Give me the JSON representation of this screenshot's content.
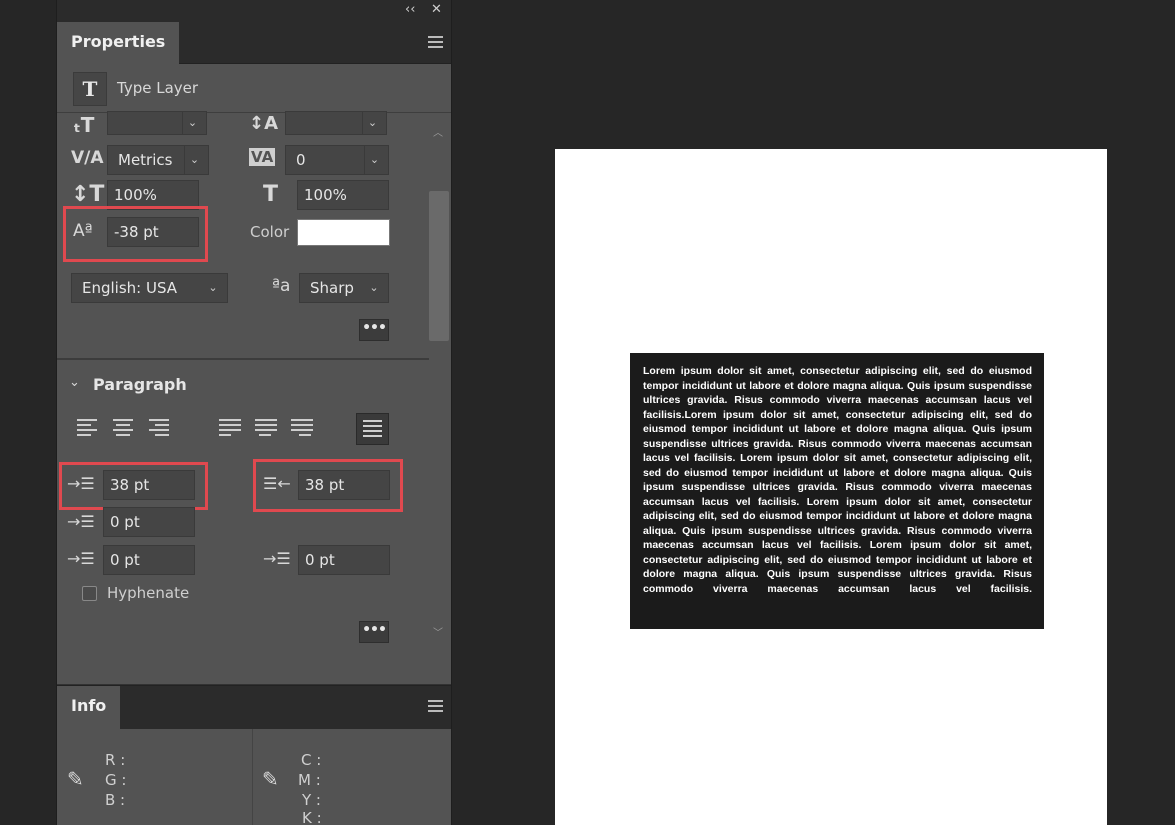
{
  "window": {
    "collapse_label": "‹‹",
    "close_label": "✕"
  },
  "properties": {
    "tab_label": "Properties",
    "layer_type_label": "Type Layer",
    "character": {
      "font_size_value": "",
      "leading_value": "",
      "kerning_value": "Metrics",
      "tracking_value": "0",
      "vertical_scale_value": "100%",
      "horizontal_scale_value": "100%",
      "baseline_shift_value": "-38 pt",
      "color_label": "Color",
      "color_value": "#ffffff",
      "language_value": "English: USA",
      "antialias_icon_text": "ªa",
      "antialias_value": "Sharp",
      "more_label": "•••"
    },
    "paragraph": {
      "section_title": "Paragraph",
      "indent_left_value": "38 pt",
      "indent_right_value": "38 pt",
      "indent_first_line_value": "0 pt",
      "space_before_value": "0 pt",
      "space_after_value": "0 pt",
      "hyphenate_label": "Hyphenate",
      "hyphenate_checked": false,
      "more_label": "•••"
    }
  },
  "info": {
    "tab_label": "Info",
    "rgb_labels": [
      "R :",
      "G :",
      "B :"
    ],
    "cmyk_labels": [
      "C :",
      "M :",
      "Y :",
      "K :"
    ]
  },
  "document": {
    "text": "Lorem ipsum dolor sit amet, consectetur adipiscing elit, sed do eiusmod tempor incididunt ut labore et dolore magna aliqua. Quis ipsum suspendisse ultrices gravida. Risus commodo viverra maecenas accumsan lacus vel facilisis.Lorem ipsum dolor sit amet, consectetur adipiscing elit, sed do eiusmod tempor incididunt ut labore et dolore magna aliqua. Quis ipsum suspendisse ultrices gravida. Risus commodo viverra maecenas accumsan lacus vel facilisis. Lorem ipsum dolor sit amet, consectetur adipiscing elit, sed do eiusmod tempor incididunt ut labore et dolore magna aliqua. Quis ipsum suspendisse ultrices gravida. Risus commodo viverra maecenas accumsan lacus vel facilisis. Lorem ipsum dolor sit amet, consectetur adipiscing elit, sed do eiusmod tempor incididunt ut labore et dolore magna aliqua. Quis ipsum suspendisse ultrices gravida. Risus commodo viverra maecenas accumsan lacus vel facilisis. Lorem ipsum dolor sit amet, consectetur adipiscing elit, sed do eiusmod tempor incididunt ut labore et dolore magna aliqua. Quis ipsum suspendisse ultrices gravida. Risus commodo viverra maecenas accumsan lacus vel facilisis.",
    "text_box_color": "#1b1b1b",
    "canvas_color": "#ffffff"
  },
  "colors": {
    "highlight": "#e0494f",
    "panel": "#535353",
    "background": "#262626"
  },
  "icons": [
    "font-size-icon",
    "leading-icon",
    "kerning-icon",
    "tracking-icon",
    "vertical-scale-icon",
    "horizontal-scale-icon",
    "baseline-shift-icon",
    "antialias-icon",
    "align-left-icon",
    "align-center-icon",
    "align-right-icon",
    "justify-last-left-icon",
    "justify-last-center-icon",
    "justify-last-right-icon",
    "justify-all-icon",
    "indent-left-icon",
    "indent-right-icon",
    "indent-first-line-icon",
    "space-before-icon",
    "space-after-icon",
    "eyedropper-icon",
    "hamburger-menu-icon"
  ]
}
